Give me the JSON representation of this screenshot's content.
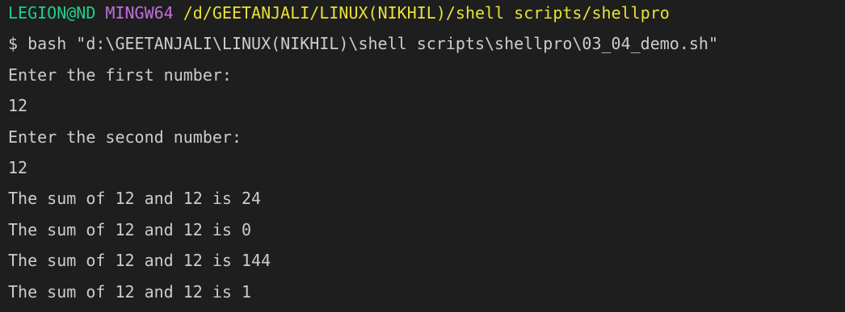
{
  "terminal": {
    "prompt": {
      "user_host": "LEGION@ND",
      "system": "MINGW64",
      "path": "/d/GEETANJALI/LINUX(NIKHIL)/shell scripts/shellpro"
    },
    "command": "$ bash \"d:\\GEETANJALI\\LINUX(NIKHIL)\\shell scripts\\shellpro\\03_04_demo.sh\"",
    "output": [
      "Enter the first number:",
      "12",
      "Enter the second number:",
      "12",
      "The sum of 12 and 12 is 24",
      "The sum of 12 and 12 is 0",
      "The sum of 12 and 12 is 144",
      "The sum of 12 and 12 is 1"
    ]
  },
  "colors": {
    "background": "#1e1e1e",
    "text": "#cccccc",
    "user_host": "#1ecf8b",
    "system": "#c56de0",
    "path": "#e9e03a"
  }
}
